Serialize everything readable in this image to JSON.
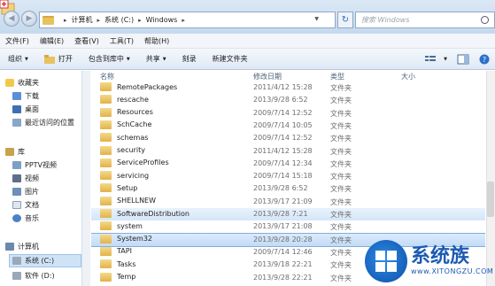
{
  "address": {
    "crumbs": [
      "计算机",
      "系统 (C:)",
      "Windows"
    ],
    "search_placeholder": "搜索 Windows"
  },
  "menu": [
    "文件(F)",
    "编辑(E)",
    "查看(V)",
    "工具(T)",
    "帮助(H)"
  ],
  "toolbar": {
    "organize": "组织",
    "open": "打开",
    "include_in_library": "包含到库中",
    "share": "共享",
    "burn": "刻录",
    "new_folder": "新建文件夹"
  },
  "nav": {
    "favorites": "收藏夹",
    "downloads": "下载",
    "desktop": "桌面",
    "recent": "最近访问的位置",
    "libraries": "库",
    "pptv": "PPTV视频",
    "videos": "视频",
    "pictures": "图片",
    "documents": "文档",
    "music": "音乐",
    "computer": "计算机",
    "system_c": "系统 (C:)",
    "software_d": "软件 (D:)"
  },
  "columns": {
    "name": "名称",
    "date": "修改日期",
    "type": "类型",
    "size": "大小"
  },
  "files": [
    {
      "name": "RemotePackages",
      "date": "2011/4/12 15:28",
      "type": "文件夹"
    },
    {
      "name": "rescache",
      "date": "2013/9/28 6:52",
      "type": "文件夹"
    },
    {
      "name": "Resources",
      "date": "2009/7/14 12:52",
      "type": "文件夹"
    },
    {
      "name": "SchCache",
      "date": "2009/7/14 10:05",
      "type": "文件夹"
    },
    {
      "name": "schemas",
      "date": "2009/7/14 12:52",
      "type": "文件夹"
    },
    {
      "name": "security",
      "date": "2011/4/12 15:28",
      "type": "文件夹"
    },
    {
      "name": "ServiceProfiles",
      "date": "2009/7/14 12:34",
      "type": "文件夹"
    },
    {
      "name": "servicing",
      "date": "2009/7/14 15:18",
      "type": "文件夹"
    },
    {
      "name": "Setup",
      "date": "2013/9/28 6:52",
      "type": "文件夹"
    },
    {
      "name": "SHELLNEW",
      "date": "2013/9/17 21:09",
      "type": "文件夹"
    },
    {
      "name": "SoftwareDistribution",
      "date": "2013/9/28 7:21",
      "type": "文件夹"
    },
    {
      "name": "system",
      "date": "2013/9/17 21:08",
      "type": "文件夹"
    },
    {
      "name": "System32",
      "date": "2013/9/28 20:28",
      "type": "文件夹"
    },
    {
      "name": "TAPI",
      "date": "2009/7/14 12:46",
      "type": "文件夹"
    },
    {
      "name": "Tasks",
      "date": "2013/9/18 22:21",
      "type": "文件夹"
    },
    {
      "name": "Temp",
      "date": "2013/9/28 22:21",
      "type": "文件夹"
    }
  ],
  "watermark": {
    "cn": "系统族",
    "url": "www.XITONGZU.COM"
  }
}
